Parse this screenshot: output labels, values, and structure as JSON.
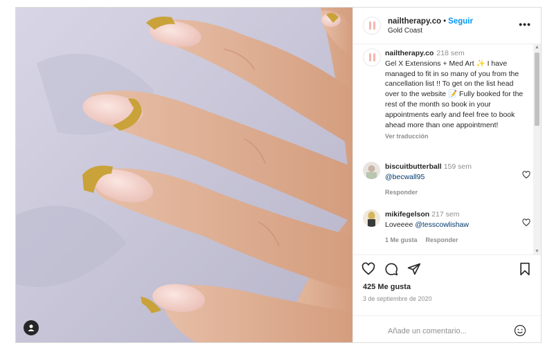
{
  "post": {
    "username": "nailtherapy.co",
    "separator": "•",
    "follow_label": "Seguir",
    "location": "Gold Coast",
    "more_label": "•••"
  },
  "caption": {
    "username": "nailtherapy.co",
    "time": "218 sem",
    "text": "Gel X Extensions + Med Art ✨ I have managed to fit in so many of you from the cancellation list !! To get on the list head over to the website 📝 Fully booked for the rest of the month so book in your appointments early and feel free to book ahead more than one appointment!",
    "translate_label": "Ver traducción"
  },
  "comments": [
    {
      "username": "biscuitbutterball",
      "time": "159 sem",
      "mention": "@becwall95",
      "text": "",
      "reply_label": "Responder"
    },
    {
      "username": "mikifegelson",
      "time": "217 sem",
      "mention": "@tesscowlishaw",
      "text": "Loveeee",
      "likes_label": "1 Me gusta",
      "reply_label": "Responder"
    }
  ],
  "icons": [
    "user-tag-icon",
    "heart-icon",
    "comment-icon",
    "share-icon",
    "bookmark-icon",
    "emoji-icon",
    "more-icon"
  ],
  "likes": "425 Me gusta",
  "date": "3 de septiembre de 2020",
  "comment_input": {
    "placeholder": "Añade un comentario..."
  },
  "colors": {
    "link": "#0095f6",
    "text": "#262626",
    "muted": "#8e8e8e",
    "mention": "#00376b",
    "avatar_accent": "#f3b7b0"
  }
}
